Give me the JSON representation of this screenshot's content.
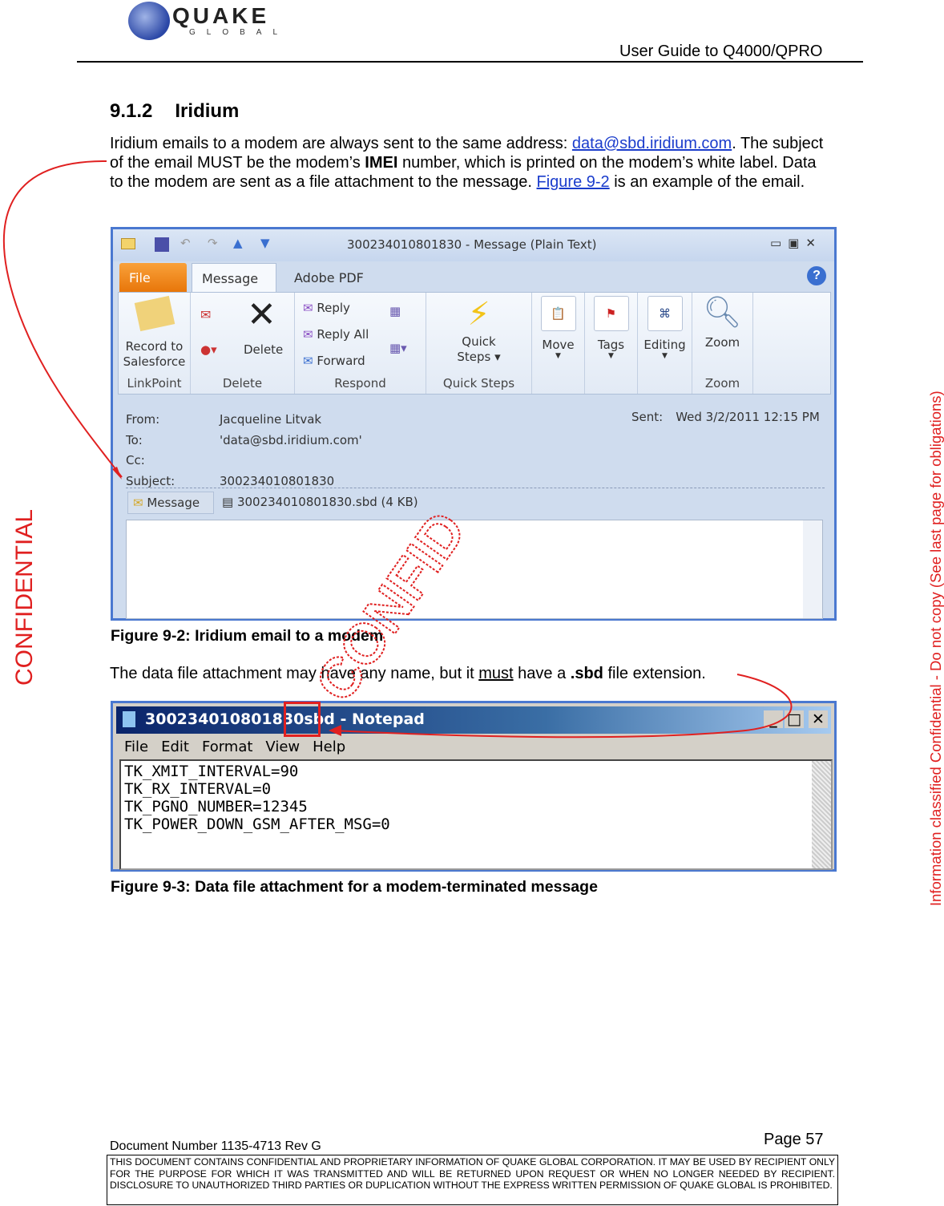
{
  "header": {
    "logo_main": "QUAKE",
    "logo_sub": "GLOBAL",
    "doc_title": "User Guide to Q4000/QPRO"
  },
  "section": {
    "number": "9.1.2",
    "title": "Iridium"
  },
  "paragraph1": {
    "t1": "Iridium emails to a modem are always sent to the same address: ",
    "email": "data@sbd.iridium.com",
    "t2": ".  The subject of the email MUST be the modem’s ",
    "imei": "IMEI",
    "t3": " number, which is printed on the modem’s white label.  Data to the modem are sent as a file attachment to the message.  ",
    "figlink": "Figure 9-2",
    "t4": " is an example of the email."
  },
  "outlook": {
    "title": "300234010801830  -  Message (Plain Text)",
    "tabs": [
      "File",
      "Message",
      "Adobe PDF"
    ],
    "groups": {
      "linkpoint": "LinkPoint",
      "record": "Record to",
      "salesforce": "Salesforce",
      "delete_group": "Delete",
      "delete": "Delete",
      "respond": "Respond",
      "reply": "Reply",
      "reply_all": "Reply All",
      "forward": "Forward",
      "quick": "Quick",
      "steps": "Steps",
      "quick_steps": "Quick Steps",
      "move": "Move",
      "tags": "Tags",
      "editing": "Editing",
      "zoom": "Zoom",
      "zoom_group": "Zoom"
    },
    "from_label": "From:",
    "from": "Jacqueline Litvak",
    "to_label": "To:",
    "to": "'data@sbd.iridium.com'",
    "cc_label": "Cc:",
    "subject_label": "Subject:",
    "subject": "300234010801830",
    "sent_label": "Sent:",
    "sent": "Wed 3/2/2011 12:15 PM",
    "message_tab": "Message",
    "attachment": "300234010801830.sbd (4 KB)"
  },
  "caption1": "Figure 9-2:  Iridium email to a modem",
  "paragraph2": {
    "t1": "The data file attachment may have any name, but it ",
    "must": "must",
    "t2": " have a ",
    "sbd": ".sbd",
    "t3": " file extension."
  },
  "notepad": {
    "title_a": "300234010801830",
    "title_b": "sbd",
    "title_c": " - Notepad",
    "menu": [
      "File",
      "Edit",
      "Format",
      "View",
      "Help"
    ],
    "lines": [
      "TK_XMIT_INTERVAL=90",
      "TK_RX_INTERVAL=0",
      "TK_PGNO_NUMBER=12345",
      "TK_POWER_DOWN_GSM_AFTER_MSG=0"
    ]
  },
  "caption2": "Figure 9-3:  Data file attachment for a modem-terminated message",
  "footer": {
    "doc_number": "Document Number 1135-4713   Rev G",
    "page": "Page 57",
    "legal": "THIS DOCUMENT CONTAINS CONFIDENTIAL AND PROPRIETARY INFORMATION OF QUAKE GLOBAL CORPORATION.  IT MAY BE USED BY RECIPIENT ONLY FOR THE PURPOSE FOR WHICH IT WAS TRANSMITTED AND WILL BE RETURNED UPON REQUEST OR WHEN NO LONGER NEEDED BY RECIPIENT.  DISCLOSURE TO UNAUTHORIZED THIRD PARTIES OR DUPLICATION WITHOUT THE EXPRESS WRITTEN PERMISSION OF QUAKE GLOBAL IS PROHIBITED."
  },
  "side": {
    "left": "CONFIDENTIAL",
    "right": "Information classified Confidential - Do not copy (See last page for obligations)",
    "watermark": "CONFIDENTIAL"
  },
  "colors": {
    "annotation_red": "#e02020",
    "link": "#1a3ccc",
    "window_border": "#4a78d0"
  }
}
